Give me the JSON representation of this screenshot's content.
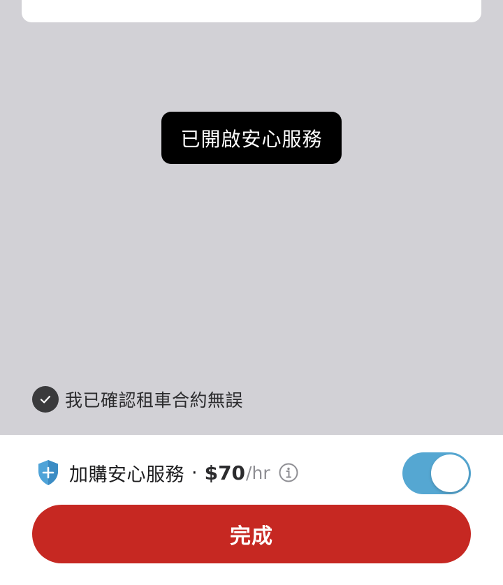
{
  "toast": {
    "message": "已開啟安心服務"
  },
  "confirm": {
    "checked": true,
    "label": "我已確認租車合約無誤",
    "icon": "check-icon"
  },
  "service": {
    "icon": "shield-plus-icon",
    "label": "加購安心服務",
    "separator": "·",
    "price": "$70",
    "unit": "/hr",
    "info_icon": "info-icon",
    "toggle_on": true,
    "toggle_color": "#55a7d2"
  },
  "actions": {
    "done_label": "完成",
    "done_color": "#c62822"
  }
}
